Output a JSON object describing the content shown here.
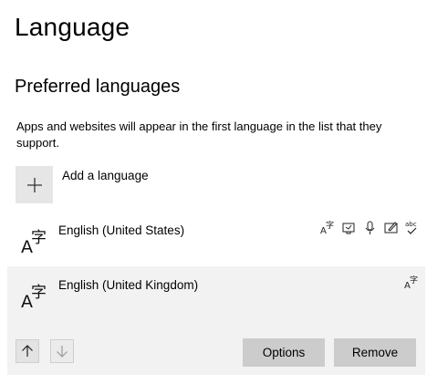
{
  "page": {
    "title": "Language"
  },
  "preferred": {
    "heading": "Preferred languages",
    "description": "Apps and websites will appear in the first language in the list that they support.",
    "add_label": "Add a language"
  },
  "languages": [
    {
      "name": "English (United States)",
      "features": [
        "language-pack-icon",
        "text-to-speech-icon",
        "speech-recognition-icon",
        "handwriting-icon",
        "spell-check-icon"
      ]
    },
    {
      "name": "English (United Kingdom)",
      "features": [
        "language-pack-icon"
      ],
      "selected": true
    }
  ],
  "actions": {
    "move_up": "up-arrow-icon",
    "move_down": "down-arrow-icon",
    "options_label": "Options",
    "remove_label": "Remove"
  },
  "colors": {
    "background": "#ffffff",
    "selected_row": "#f2f2f2",
    "button": "#cccccc",
    "add_tile": "#e6e6e6"
  }
}
